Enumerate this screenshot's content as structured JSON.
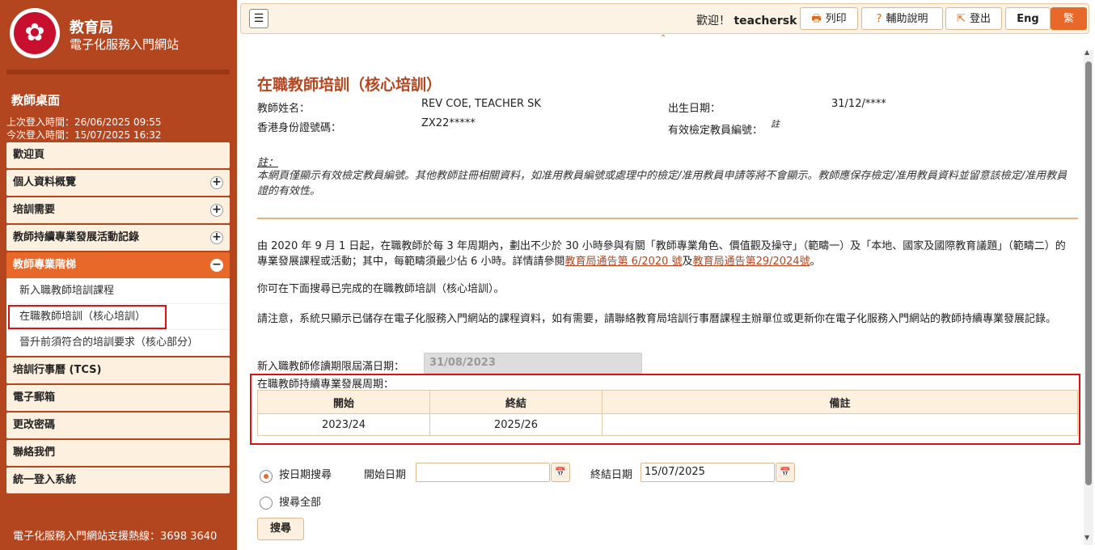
{
  "brand": {
    "title": "教育局",
    "subtitle": "電子化服務入門網站"
  },
  "sidebar": {
    "desk_title": "教師桌面",
    "last_login": "上次登入時間：26/06/2025 09:55",
    "this_login": "今次登入時間：15/07/2025 16:32",
    "items": [
      {
        "label": "歡迎頁",
        "toggle": ""
      },
      {
        "label": "個人資料概覽",
        "toggle": "+"
      },
      {
        "label": "培訓需要",
        "toggle": "+"
      },
      {
        "label": "教師持續專業發展活動記錄",
        "toggle": "+"
      },
      {
        "label": "教師專業階梯",
        "toggle": "−"
      }
    ],
    "subitems": [
      "新入職教師培訓課程",
      "在職教師培訓（核心培訓）",
      "晉升前須符合的培訓要求（核心部分）"
    ],
    "items2": [
      "培訓行事曆 (TCS)",
      "電子郵箱",
      "更改密碼",
      "聯絡我們",
      "統一登入系統"
    ],
    "hotline": "電子化服務入門網站支援熱線：3698 3640"
  },
  "topbar": {
    "welcome_prefix": "歡迎！",
    "username": "teachersk",
    "print": "列印",
    "help": "輔助說明",
    "logout": "登出",
    "lang_en": "Eng",
    "lang_tc": "繁"
  },
  "main": {
    "title": "在職教師培訓（核心培訓）",
    "name_label": "教師姓名：",
    "name_value": "REV COE, TEACHER SK",
    "dob_label": "出生日期：",
    "dob_value": "31/12/****",
    "hkid_label": "香港身份證號碼：",
    "hkid_value": "ZX22*****",
    "regno_label": "有效檢定教員編號：",
    "regno_value": "註",
    "note_label": "註：",
    "note_text": "本網頁僅顯示有效檢定教員編號。其他教師註冊相關資料，如准用教員編號或處理中的檢定/准用教員申請等將不會顯示。教師應保存檢定/准用教員資料並留意該檢定/准用教員證的有效性。",
    "para1_a": "由 2020 年 9 月 1 日起，在職教師於每 3 年周期內，劃出不少於 30 小時參與有關「教師專業角色、價值觀及操守」（範疇一）及「本地、國家及國際教育議題」（範疇二）的專業發展課程或活動；其中，每範疇須最少佔 6 小時。詳情請參閱",
    "link1": "教育局通告第 6/2020 號",
    "para1_b": "及",
    "link2": "教育局通告第29/2024號",
    "para1_c": "。",
    "para2": "你可在下面搜尋已完成的在職教師培訓（核心培訓）。",
    "para3": "請注意，系統只顯示已儲存在電子化服務入門網站的課程資料，如有需要，請聯絡教育局培訓行事曆課程主辦單位或更新你在電子化服務入門網站的教師持續專業發展記錄。",
    "deadline_label": "新入職教師修讀期限屆滿日期：",
    "deadline_value": "31/08/2023",
    "cycle_label": "在職教師持續專業發展周期：",
    "cycle_headers": [
      "開始",
      "終結",
      "備註"
    ],
    "cycle_rows": [
      [
        "2023/24",
        "2025/26",
        ""
      ]
    ],
    "radio_by_date": "按日期搜尋",
    "start_label": "開始日期",
    "start_value": "",
    "end_label": "終結日期",
    "end_value": "15/07/2025",
    "radio_all": "搜尋全部",
    "search_btn": "搜尋"
  }
}
